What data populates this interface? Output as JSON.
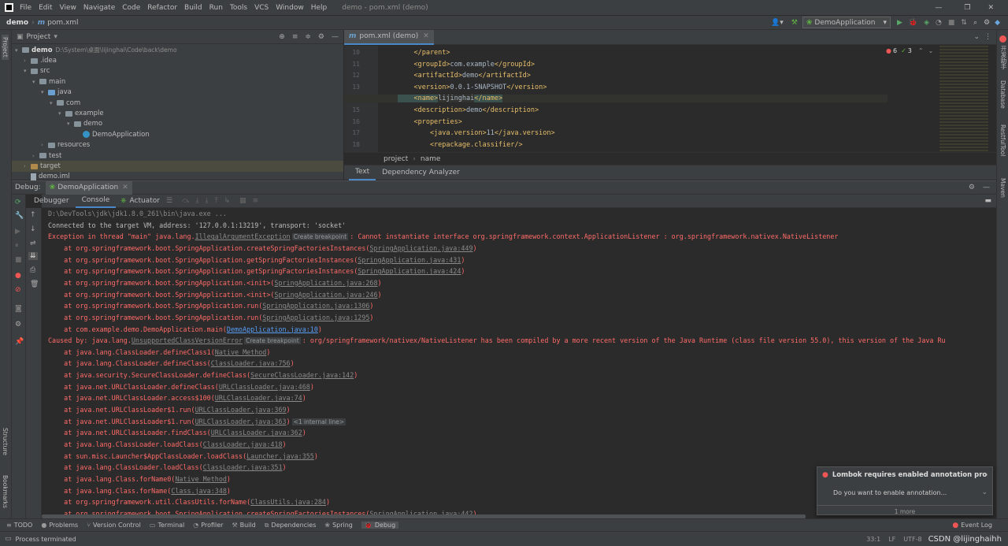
{
  "menu": [
    "File",
    "Edit",
    "View",
    "Navigate",
    "Code",
    "Refactor",
    "Build",
    "Run",
    "Tools",
    "VCS",
    "Window",
    "Help"
  ],
  "window_title": "demo - pom.xml (demo)",
  "nav": {
    "project": "demo",
    "file": "pom.xml"
  },
  "run_config": "DemoApplication",
  "project_panel": {
    "title": "Project",
    "tree": [
      {
        "indent": 0,
        "label": "demo",
        "extra": "D:\\System\\桌面\\lijinghai\\Code\\back\\demo",
        "arrow": "▾",
        "icon": "folder",
        "bold": true
      },
      {
        "indent": 1,
        "label": ".idea",
        "arrow": "›",
        "icon": "folder"
      },
      {
        "indent": 1,
        "label": "src",
        "arrow": "▾",
        "icon": "folder"
      },
      {
        "indent": 2,
        "label": "main",
        "arrow": "▾",
        "icon": "folder"
      },
      {
        "indent": 3,
        "label": "java",
        "arrow": "▾",
        "icon": "blue"
      },
      {
        "indent": 4,
        "label": "com",
        "arrow": "▾",
        "icon": "folder"
      },
      {
        "indent": 5,
        "label": "example",
        "arrow": "▾",
        "icon": "folder"
      },
      {
        "indent": 6,
        "label": "demo",
        "arrow": "▾",
        "icon": "folder"
      },
      {
        "indent": 7,
        "label": "DemoApplication",
        "arrow": "",
        "icon": "class"
      },
      {
        "indent": 3,
        "label": "resources",
        "arrow": "›",
        "icon": "folder"
      },
      {
        "indent": 2,
        "label": "test",
        "arrow": "›",
        "icon": "folder"
      },
      {
        "indent": 1,
        "label": "target",
        "arrow": "›",
        "icon": "or",
        "selected": true
      },
      {
        "indent": 1,
        "label": "demo.iml",
        "arrow": "",
        "icon": "file"
      }
    ]
  },
  "editor": {
    "tab": "pom.xml (demo)",
    "inspections": {
      "errors": "6",
      "checks": "3"
    },
    "lines": [
      {
        "n": "10",
        "html": "    </parent>"
      },
      {
        "n": "11",
        "tag1": "    <groupId>",
        "text": "com.example",
        "tag2": "</groupId>"
      },
      {
        "n": "12",
        "tag1": "    <artifactId>",
        "text": "demo",
        "tag2": "</artifactId>"
      },
      {
        "n": "13",
        "tag1": "    <version>",
        "text": "0.0.1-SNAPSHOT",
        "tag2": "</version>"
      },
      {
        "n": "14",
        "tag1": "    <name>",
        "text": "lijinghai",
        "tag2": "</name>"
      },
      {
        "n": "15",
        "tag1": "    <description>",
        "text": "demo",
        "tag2": "</description>"
      },
      {
        "n": "16",
        "tag1": "    <properties>",
        "text": "",
        "tag2": ""
      },
      {
        "n": "17",
        "tag1": "        <java.version>",
        "text": "11",
        "tag2": "</java.version>"
      },
      {
        "n": "18",
        "tag1": "        <repackage.classifier/>",
        "text": "",
        "tag2": ""
      }
    ],
    "breadcrumb": [
      "project",
      "name"
    ],
    "subtabs": [
      "Text",
      "Dependency Analyzer"
    ]
  },
  "debug": {
    "label": "Debug:",
    "tab": "DemoApplication",
    "tabs": [
      "Debugger",
      "Console",
      "Actuator"
    ]
  },
  "console": {
    "cmd": "D:\\DevTools\\jdk\\jdk1.8.0_261\\bin\\java.exe ...",
    "connected": "Connected to the target VM, address: '127.0.0.1:13219', transport: 'socket'",
    "ex_prefix": "Exception in thread \"main\" java.lang.",
    "ex_class": "IllegalArgumentException",
    "ex_msg": ": Cannot instantiate interface org.springframework.context.ApplicationListener : org.springframework.nativex.NativeListener",
    "create_bp": "Create breakpoint",
    "trace1": [
      {
        "pre": "    at org.springframework.boot.SpringApplication.createSpringFactoriesInstances(",
        "link": "SpringApplication.java:449",
        "post": ")"
      },
      {
        "pre": "    at org.springframework.boot.SpringApplication.getSpringFactoriesInstances(",
        "link": "SpringApplication.java:431",
        "post": ")"
      },
      {
        "pre": "    at org.springframework.boot.SpringApplication.getSpringFactoriesInstances(",
        "link": "SpringApplication.java:424",
        "post": ")"
      },
      {
        "pre": "    at org.springframework.boot.SpringApplication.<init>(",
        "link": "SpringApplication.java:268",
        "post": ")"
      },
      {
        "pre": "    at org.springframework.boot.SpringApplication.<init>(",
        "link": "SpringApplication.java:246",
        "post": ")"
      },
      {
        "pre": "    at org.springframework.boot.SpringApplication.run(",
        "link": "SpringApplication.java:1306",
        "post": ")"
      },
      {
        "pre": "    at org.springframework.boot.SpringApplication.run(",
        "link": "SpringApplication.java:1295",
        "post": ")"
      }
    ],
    "main_pre": "    at com.example.demo.DemoApplication.main(",
    "main_link": "DemoApplication.java:10",
    "caused_prefix": "Caused by: java.lang.",
    "caused_class": "UnsupportedClassVersionError",
    "caused_msg": ": org/springframework/nativex/NativeListener has been compiled by a more recent version of the Java Runtime (class file version 55.0), this version of the Java Ru",
    "trace2": [
      {
        "pre": "    at java.lang.ClassLoader.defineClass1(",
        "link": "Native Method",
        "post": ")"
      },
      {
        "pre": "    at java.lang.ClassLoader.defineClass(",
        "link": "ClassLoader.java:756",
        "post": ")"
      },
      {
        "pre": "    at java.security.SecureClassLoader.defineClass(",
        "link": "SecureClassLoader.java:142",
        "post": ")"
      },
      {
        "pre": "    at java.net.URLClassLoader.defineClass(",
        "link": "URLClassLoader.java:468",
        "post": ")"
      },
      {
        "pre": "    at java.net.URLClassLoader.access$100(",
        "link": "URLClassLoader.java:74",
        "post": ")"
      },
      {
        "pre": "    at java.net.URLClassLoader$1.run(",
        "link": "URLClassLoader.java:369",
        "post": ")"
      },
      {
        "pre": "    at java.net.URLClassLoader$1.run(",
        "link": "URLClassLoader.java:363",
        "post": ")",
        "badge": "<1 internal line>"
      },
      {
        "pre": "    at java.net.URLClassLoader.findClass(",
        "link": "URLClassLoader.java:362",
        "post": ")"
      },
      {
        "pre": "    at java.lang.ClassLoader.loadClass(",
        "link": "ClassLoader.java:418",
        "post": ")"
      },
      {
        "pre": "    at sun.misc.Launcher$AppClassLoader.loadClass(",
        "link": "Launcher.java:355",
        "post": ")"
      },
      {
        "pre": "    at java.lang.ClassLoader.loadClass(",
        "link": "ClassLoader.java:351",
        "post": ")"
      },
      {
        "pre": "    at java.lang.Class.forName0(",
        "link": "Native Method",
        "post": ")"
      },
      {
        "pre": "    at java.lang.Class.forName(",
        "link": "Class.java:348",
        "post": ")"
      },
      {
        "pre": "    at org.springframework.util.ClassUtils.forName(",
        "link": "ClassUtils.java:284",
        "post": ")"
      },
      {
        "pre": "    at org.springframework.boot.SpringApplication.createSpringFactoriesInstances(",
        "link": "SpringApplication.java:442",
        "post": ")"
      }
    ]
  },
  "toast": {
    "title": "Lombok requires enabled annotation process",
    "body": "Do you want to enable annotation...",
    "more": "1 more"
  },
  "bottom_tabs": [
    "TODO",
    "Problems",
    "Version Control",
    "Terminal",
    "Profiler",
    "Build",
    "Dependencies",
    "Spring",
    "Debug"
  ],
  "event_log": "Event Log",
  "status": {
    "left": "Process terminated",
    "pos": "33:1",
    "lf": "LF",
    "enc": "UTF-8",
    "watermark": "CSDN @lijinghaihh"
  },
  "right_tools": [
    "开发助手",
    "Database",
    "RestfulTool",
    "Maven"
  ],
  "left_tools": [
    "Project",
    "Structure",
    "Bookmarks"
  ],
  "colors": {
    "error": "#ff6b68",
    "link": "#589df6",
    "tag": "#e8bf6a",
    "bg": "#2b2b2b",
    "panel": "#3c3f41"
  }
}
